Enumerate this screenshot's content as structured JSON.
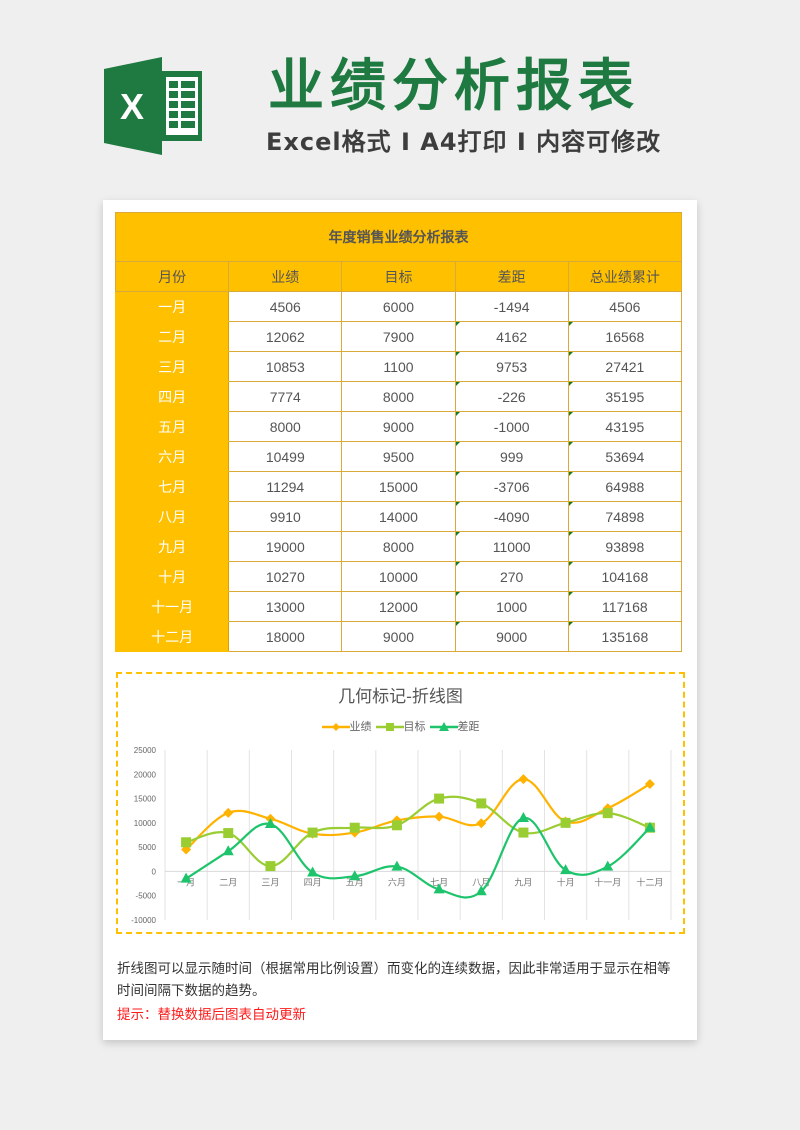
{
  "header": {
    "logo_icon": "excel-logo-icon",
    "title": "业绩分析报表",
    "subtitle": "Excel格式 I A4打印 I 内容可修改",
    "brand_color": "#1e7a40"
  },
  "table": {
    "title": "年度销售业绩分析报表",
    "columns": [
      "月份",
      "业绩",
      "目标",
      "差距",
      "总业绩累计"
    ],
    "rows": [
      [
        "一月",
        "4506",
        "6000",
        "-1494",
        "4506"
      ],
      [
        "二月",
        "12062",
        "7900",
        "4162",
        "16568"
      ],
      [
        "三月",
        "10853",
        "1100",
        "9753",
        "27421"
      ],
      [
        "四月",
        "7774",
        "8000",
        "-226",
        "35195"
      ],
      [
        "五月",
        "8000",
        "9000",
        "-1000",
        "43195"
      ],
      [
        "六月",
        "10499",
        "9500",
        "999",
        "53694"
      ],
      [
        "七月",
        "11294",
        "15000",
        "-3706",
        "64988"
      ],
      [
        "八月",
        "9910",
        "14000",
        "-4090",
        "74898"
      ],
      [
        "九月",
        "19000",
        "8000",
        "11000",
        "93898"
      ],
      [
        "十月",
        "10270",
        "10000",
        "270",
        "104168"
      ],
      [
        "十一月",
        "13000",
        "12000",
        "1000",
        "117168"
      ],
      [
        "十二月",
        "18000",
        "9000",
        "9000",
        "135168"
      ]
    ],
    "accent_color": "#ffc000"
  },
  "chart_data": {
    "type": "line",
    "title": "几何标记-折线图",
    "categories": [
      "一月",
      "二月",
      "三月",
      "四月",
      "五月",
      "六月",
      "七月",
      "八月",
      "九月",
      "十月",
      "十一月",
      "十二月"
    ],
    "series": [
      {
        "name": "业绩",
        "marker": "diamond",
        "color": "#ffb300",
        "values": [
          4506,
          12062,
          10853,
          7774,
          8000,
          10499,
          11294,
          9910,
          19000,
          10270,
          13000,
          18000
        ]
      },
      {
        "name": "目标",
        "marker": "square",
        "color": "#9acd32",
        "values": [
          6000,
          7900,
          1100,
          8000,
          9000,
          9500,
          15000,
          14000,
          8000,
          10000,
          12000,
          9000
        ]
      },
      {
        "name": "差距",
        "marker": "triangle",
        "color": "#1dc46c",
        "values": [
          -1494,
          4162,
          9753,
          -226,
          -1000,
          999,
          -3706,
          -4090,
          11000,
          270,
          1000,
          9000
        ]
      }
    ],
    "ylim": [
      -10000,
      25000
    ],
    "yticks": [
      25000,
      20000,
      15000,
      10000,
      5000,
      0,
      -5000,
      -10000
    ],
    "grid": "vertical",
    "legend": "top",
    "smooth": true,
    "xlabel": "",
    "ylabel": ""
  },
  "notes": {
    "description": "折线图可以显示随时间（根据常用比例设置）而变化的连续数据，因此非常适用于显示在相等时间间隔下数据的趋势。",
    "tip": "提示：替换数据后图表自动更新",
    "tip_color": "#ff1a1a"
  }
}
